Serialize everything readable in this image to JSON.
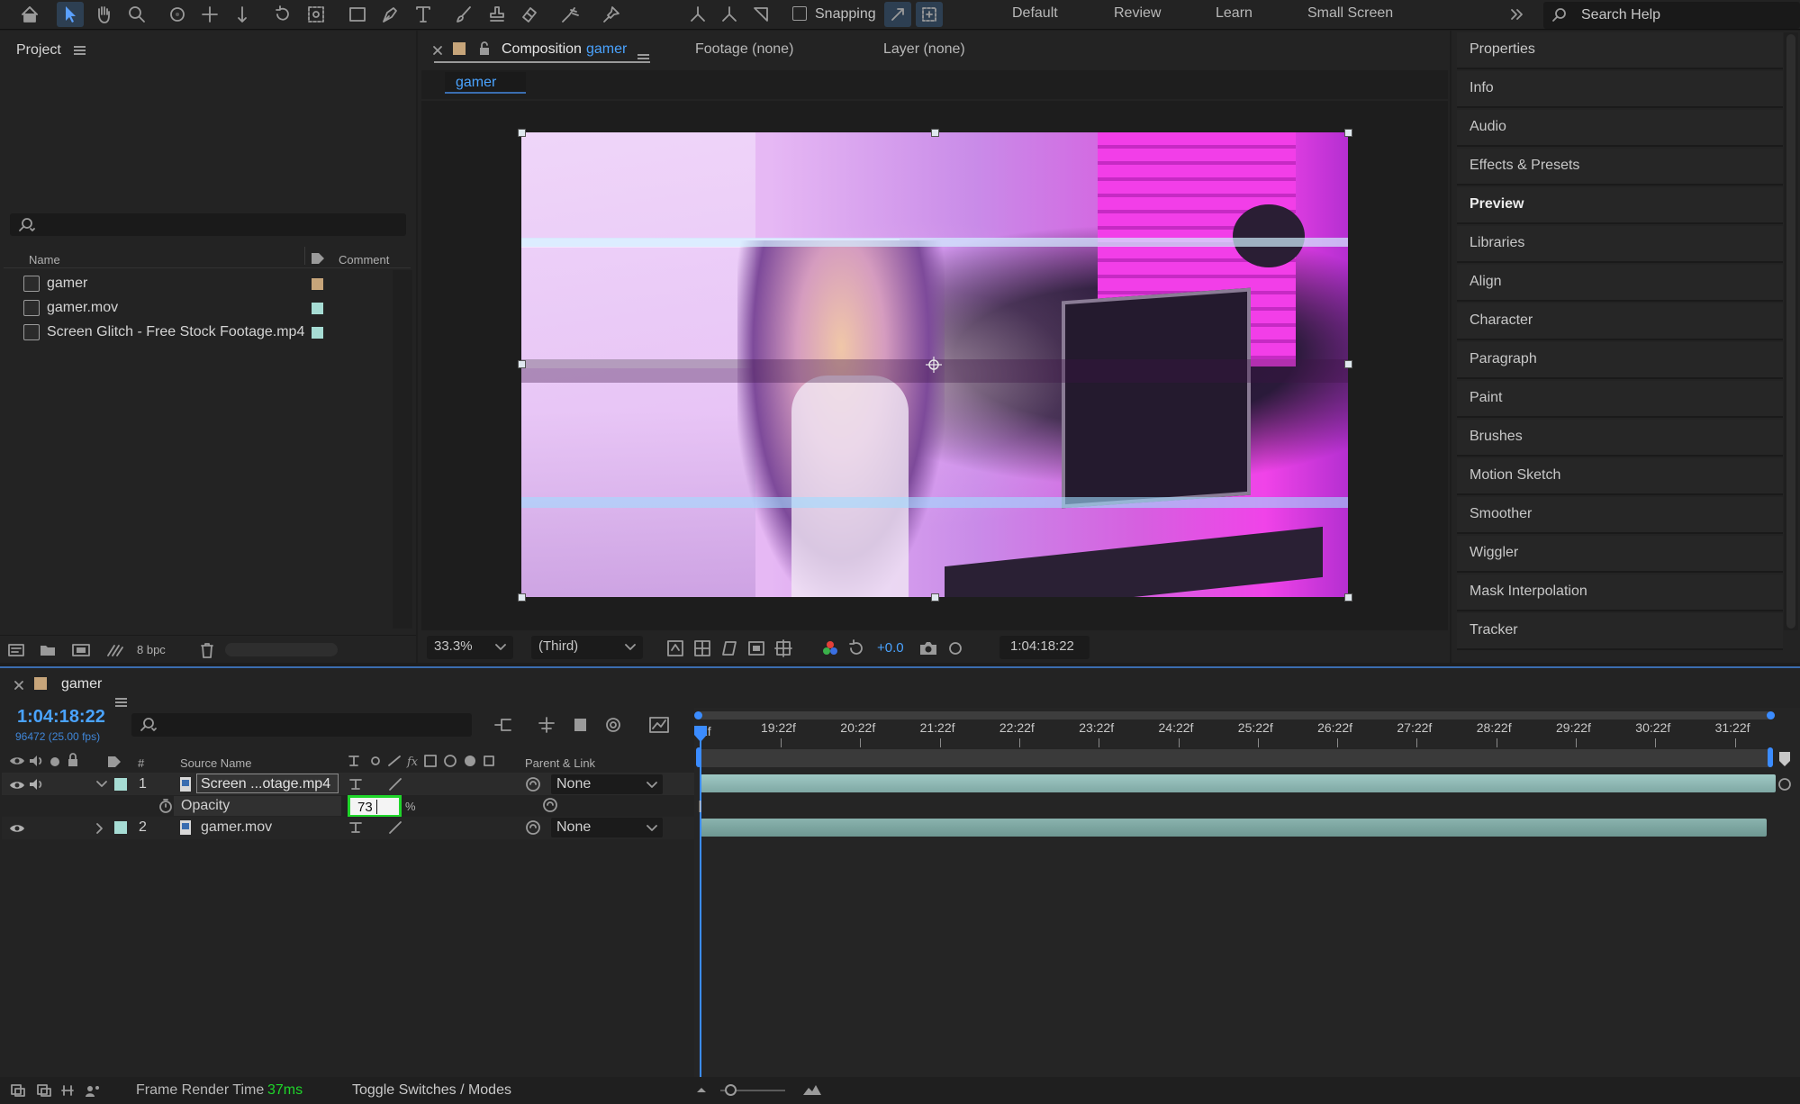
{
  "workspaces": [
    "Default",
    "Review",
    "Learn",
    "Small Screen"
  ],
  "snapping_label": "Snapping",
  "search_help_placeholder": "Search Help",
  "project": {
    "title": "Project",
    "col_name": "Name",
    "col_comment": "Comment",
    "items": [
      {
        "name": "gamer",
        "type": "composition",
        "color": "#c7a57a"
      },
      {
        "name": "gamer.mov",
        "type": "footage",
        "color": "#a6dcd4"
      },
      {
        "name": "Screen Glitch - Free Stock Footage.mp4",
        "type": "footage",
        "color": "#a6dcd4"
      }
    ],
    "bpc": "8 bpc"
  },
  "comp": {
    "tab_prefix": "Composition",
    "tab_name": "gamer",
    "footage_tab": "Footage (none)",
    "layer_tab": "Layer (none)",
    "breadcrumb": "gamer",
    "zoom": "33.3%",
    "resolution": "(Third)",
    "exposure": "+0.0",
    "timecode": "1:04:18:22"
  },
  "right_panels": [
    "Properties",
    "Info",
    "Audio",
    "Effects & Presets",
    "Preview",
    "Libraries",
    "Align",
    "Character",
    "Paragraph",
    "Paint",
    "Brushes",
    "Motion Sketch",
    "Smoother",
    "Wiggler",
    "Mask Interpolation",
    "Tracker"
  ],
  "right_panel_active": "Preview",
  "timeline": {
    "comp_name": "gamer",
    "timecode": "1:04:18:22",
    "frame_info": "96472 (25.00 fps)",
    "col_num": "#",
    "col_source": "Source Name",
    "col_parent": "Parent & Link",
    "layers": [
      {
        "index": "1",
        "name": "Screen ...otage.mp4",
        "parent": "None",
        "color": "#a6dcd4"
      },
      {
        "index": "2",
        "name": "gamer.mov",
        "parent": "None",
        "color": "#a6dcd4"
      }
    ],
    "opacity_label": "Opacity",
    "opacity_value": "73",
    "opacity_unit": "%",
    "ruler": [
      "19:22f",
      "20:22f",
      "21:22f",
      "22:22f",
      "23:22f",
      "24:22f",
      "25:22f",
      "26:22f",
      "27:22f",
      "28:22f",
      "29:22f",
      "30:22f",
      "31:22f"
    ],
    "ruler_first": "2f"
  },
  "status": {
    "frame_render_label": "Frame Render Time",
    "frame_render_value": "37ms",
    "toggle_label": "Toggle Switches / Modes"
  }
}
